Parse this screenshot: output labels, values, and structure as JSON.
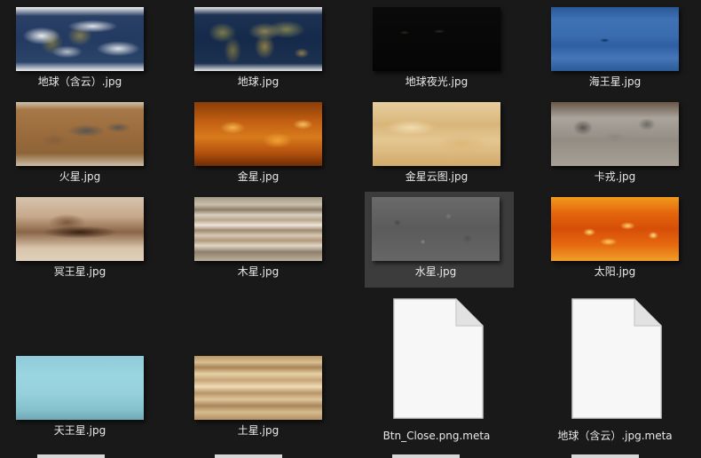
{
  "files": [
    {
      "name": "地球（含云）.jpg",
      "kind": "image",
      "texture": "earth-clouds"
    },
    {
      "name": "地球.jpg",
      "kind": "image",
      "texture": "earth"
    },
    {
      "name": "地球夜光.jpg",
      "kind": "image",
      "texture": "earth-night"
    },
    {
      "name": "海王星.jpg",
      "kind": "image",
      "texture": "neptune"
    },
    {
      "name": "火星.jpg",
      "kind": "image",
      "texture": "mars"
    },
    {
      "name": "金星.jpg",
      "kind": "image",
      "texture": "venus"
    },
    {
      "name": "金星云图.jpg",
      "kind": "image",
      "texture": "venus-clouds"
    },
    {
      "name": "卡戎.jpg",
      "kind": "image",
      "texture": "charon"
    },
    {
      "name": "冥王星.jpg",
      "kind": "image",
      "texture": "pluto"
    },
    {
      "name": "木星.jpg",
      "kind": "image",
      "texture": "jupiter"
    },
    {
      "name": "水星.jpg",
      "kind": "image",
      "texture": "mercury",
      "selected": true
    },
    {
      "name": "太阳.jpg",
      "kind": "image",
      "texture": "sun"
    },
    {
      "name": "天王星.jpg",
      "kind": "image",
      "texture": "uranus"
    },
    {
      "name": "土星.jpg",
      "kind": "image",
      "texture": "saturn"
    },
    {
      "name": "Btn_Close.png.meta",
      "kind": "file",
      "icon": "document-icon"
    },
    {
      "name": "地球（含云）.jpg.meta",
      "kind": "file",
      "icon": "document-icon"
    }
  ],
  "colors": {
    "background": "#191919",
    "selection": "#3c3c3c",
    "label_text": "#e8e8e8"
  }
}
